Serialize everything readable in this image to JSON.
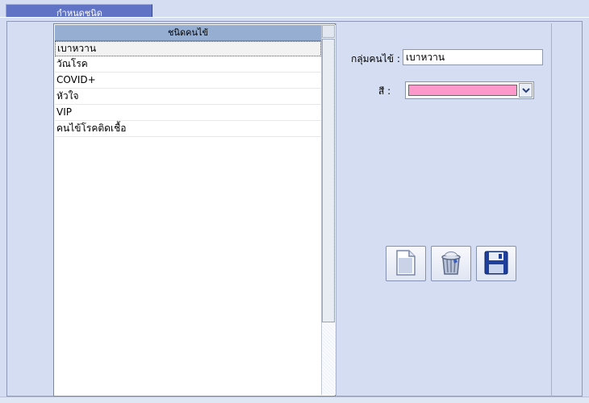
{
  "tab": {
    "label": "กำหนดชนิด"
  },
  "list": {
    "header": "ชนิดคนไข้",
    "items": [
      "เบาหวาน",
      "วัณโรค",
      "COVID+",
      "หัวใจ",
      "VIP",
      "คนไข้โรคติดเชื้อ"
    ],
    "selected_index": 0
  },
  "form": {
    "group_label": "กลุ่มคนไข้ :",
    "group_value": "เบาหวาน",
    "color_label": "สี :",
    "color_value": "#ff99cc"
  },
  "actions": [
    {
      "name": "new-button",
      "icon": "new-document-icon"
    },
    {
      "name": "delete-button",
      "icon": "trash-icon"
    },
    {
      "name": "save-button",
      "icon": "floppy-disk-icon"
    }
  ]
}
